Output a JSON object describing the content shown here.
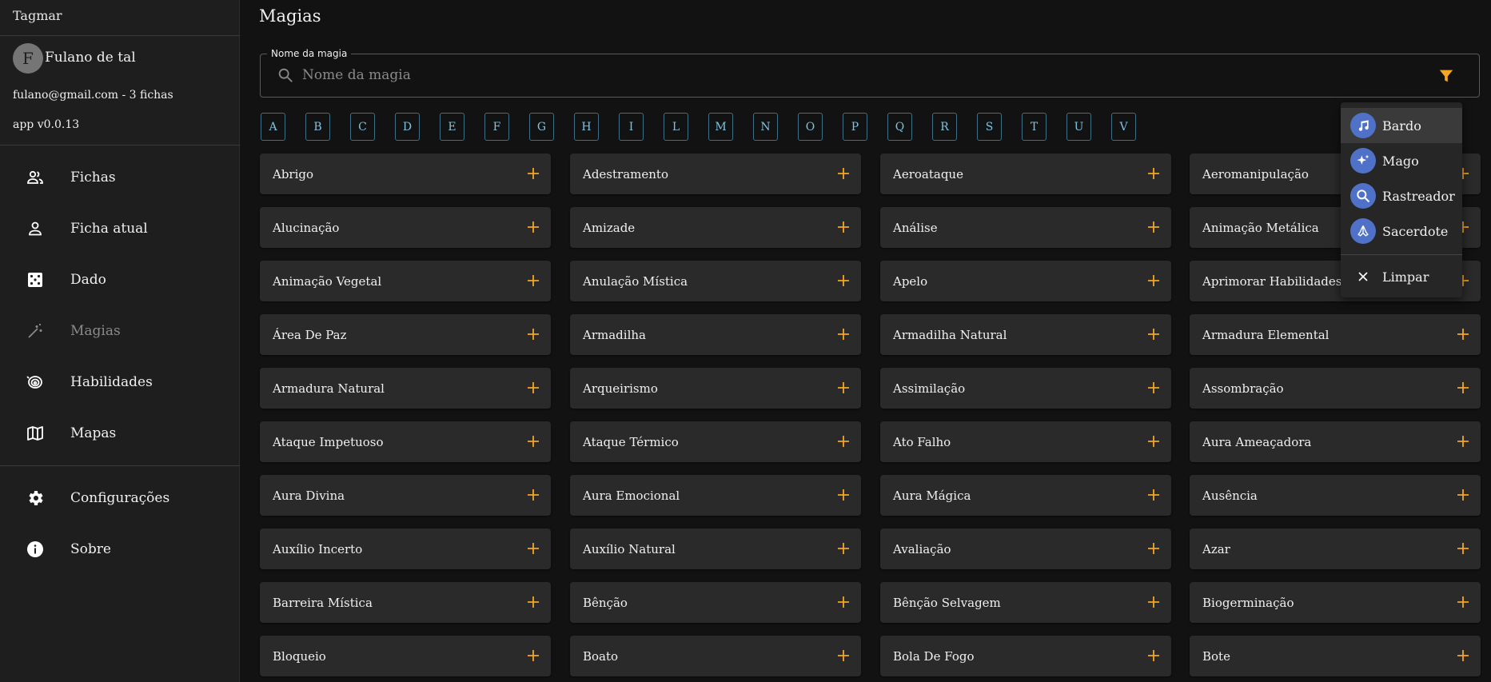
{
  "sidebar": {
    "app_title": "Tagmar",
    "user": {
      "avatar_letter": "F",
      "name": "Fulano de tal",
      "email_line": "fulano@gmail.com - 3 fichas"
    },
    "version": "app v0.0.13",
    "nav": [
      {
        "label": "Fichas",
        "icon": "people-icon"
      },
      {
        "label": "Ficha atual",
        "icon": "person-icon"
      },
      {
        "label": "Dado",
        "icon": "dice-icon"
      },
      {
        "label": "Magias",
        "icon": "magic-wand-icon",
        "active": true
      },
      {
        "label": "Habilidades",
        "icon": "cyclone-icon"
      },
      {
        "label": "Mapas",
        "icon": "map-icon"
      },
      {
        "label": "Configurações",
        "icon": "gear-icon"
      },
      {
        "label": "Sobre",
        "icon": "info-icon"
      }
    ]
  },
  "main": {
    "title": "Magias",
    "search": {
      "label": "Nome da magia",
      "placeholder": "Nome da magia",
      "value": ""
    },
    "letters": [
      "A",
      "B",
      "C",
      "D",
      "E",
      "F",
      "G",
      "H",
      "I",
      "L",
      "M",
      "N",
      "O",
      "P",
      "Q",
      "R",
      "S",
      "T",
      "U",
      "V"
    ],
    "spells": [
      "Abrigo",
      "Adestramento",
      "Aeroataque",
      "Aeromanipulação",
      "Alucinação",
      "Amizade",
      "Análise",
      "Animação Metálica",
      "Animação Vegetal",
      "Anulação Mística",
      "Apelo",
      "Aprimorar Habilidades",
      "Área De Paz",
      "Armadilha",
      "Armadilha Natural",
      "Armadura Elemental",
      "Armadura Natural",
      "Arqueirismo",
      "Assimilação",
      "Assombração",
      "Ataque Impetuoso",
      "Ataque Térmico",
      "Ato Falho",
      "Aura Ameaçadora",
      "Aura Divina",
      "Aura Emocional",
      "Aura Mágica",
      "Ausência",
      "Auxílio Incerto",
      "Auxílio Natural",
      "Avaliação",
      "Azar",
      "Barreira Mística",
      "Bênção",
      "Bênção Selvagem",
      "Biogerminação",
      "Bloqueio",
      "Boato",
      "Bola De Fogo",
      "Bote"
    ]
  },
  "filter_menu": {
    "items": [
      {
        "label": "Bardo",
        "icon": "music-note-icon"
      },
      {
        "label": "Mago",
        "icon": "sparkle-icon"
      },
      {
        "label": "Rastreador",
        "icon": "magnifier-icon"
      },
      {
        "label": "Sacerdote",
        "icon": "praying-hands-icon"
      }
    ],
    "clear_label": "Limpar"
  },
  "colors": {
    "accent": "#f5a623",
    "letter_border": "#3f6f86",
    "letter_text": "#7cc4e4",
    "class_icon_bg": "#4f72c8"
  }
}
